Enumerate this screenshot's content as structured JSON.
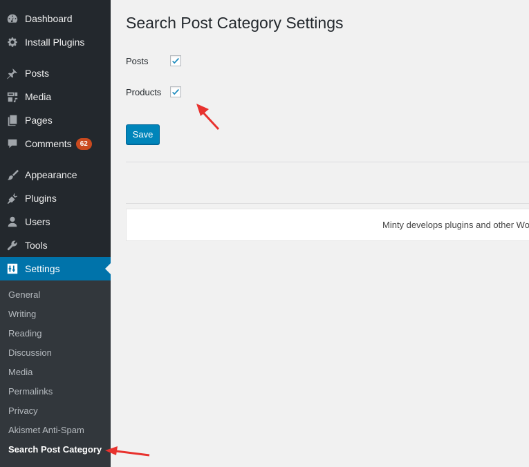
{
  "sidebar": {
    "items": [
      {
        "label": "Dashboard",
        "icon": "dashboard-icon"
      },
      {
        "label": "Install Plugins",
        "icon": "gear-icon"
      },
      {
        "label": "Posts",
        "icon": "pushpin-icon"
      },
      {
        "label": "Media",
        "icon": "media-icon"
      },
      {
        "label": "Pages",
        "icon": "pages-icon"
      },
      {
        "label": "Comments",
        "icon": "comment-icon",
        "badge": "62"
      },
      {
        "label": "Appearance",
        "icon": "paintbrush-icon"
      },
      {
        "label": "Plugins",
        "icon": "plugin-icon"
      },
      {
        "label": "Users",
        "icon": "user-icon"
      },
      {
        "label": "Tools",
        "icon": "wrench-icon"
      },
      {
        "label": "Settings",
        "icon": "settings-icon",
        "current": true
      }
    ],
    "submenu": [
      {
        "label": "General"
      },
      {
        "label": "Writing"
      },
      {
        "label": "Reading"
      },
      {
        "label": "Discussion"
      },
      {
        "label": "Media"
      },
      {
        "label": "Permalinks"
      },
      {
        "label": "Privacy"
      },
      {
        "label": "Akismet Anti-Spam"
      },
      {
        "label": "Search Post Category",
        "current": true
      }
    ]
  },
  "main": {
    "title": "Search Post Category Settings",
    "options": [
      {
        "label": "Posts",
        "checked": true
      },
      {
        "label": "Products",
        "checked": true
      }
    ],
    "save_label": "Save",
    "footer_text": "Minty develops plugins and other Wo"
  },
  "colors": {
    "sidebar_bg": "#23282d",
    "submenu_bg": "#32373c",
    "accent": "#0073aa",
    "button": "#0085ba",
    "badge": "#ca4a1f",
    "annotation_arrow": "#e8322e"
  }
}
